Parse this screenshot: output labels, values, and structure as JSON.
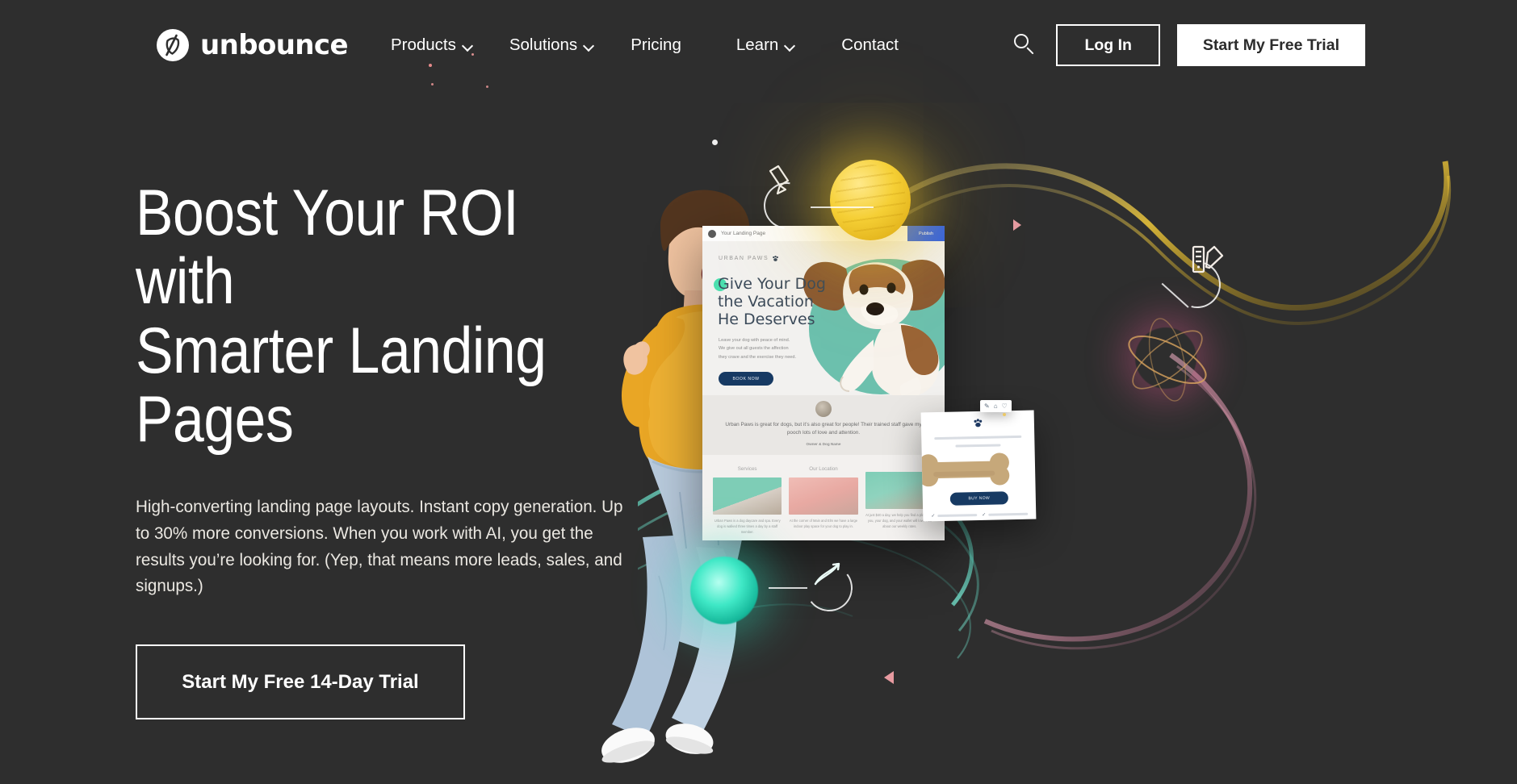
{
  "brand": {
    "name": "unbounce",
    "logo_icon": "unbounce-circle-logo"
  },
  "nav": {
    "items": [
      {
        "label": "Products",
        "has_dropdown": true
      },
      {
        "label": "Solutions",
        "has_dropdown": true
      },
      {
        "label": "Pricing",
        "has_dropdown": false
      },
      {
        "label": "Learn",
        "has_dropdown": true
      },
      {
        "label": "Contact",
        "has_dropdown": false
      }
    ],
    "search_icon": "search-icon",
    "login_label": "Log In",
    "trial_label": "Start My Free Trial"
  },
  "hero": {
    "headline": "Boost Your ROI with\nSmarter Landing\nPages",
    "subcopy": "High-converting landing page layouts. Instant copy generation. Up to 30% more conversions. When you work with AI, you get the results you’re looking for. (Yep, that means more leads, sales, and signups.)",
    "cta_label": "Start My Free 14-Day Trial"
  },
  "mockup": {
    "browser_label": "Your Landing Page",
    "publish_label": "Publish",
    "brand_label": "URBAN PAWS",
    "headline": "Give Your Dog\nthe Vacation\nHe Deserves",
    "paragraph": "Leave your dog with peace of mind.\nWe give out all guests the affection\nthey crave and the exercise they need.",
    "cta_label": "BOOK NOW",
    "testimonial_quote": "Urban Paws is great for dogs, but it’s also great for people! Their trained staff gave my pooch lots of love and attention.",
    "testimonial_attrib": "Owner & Dog Name",
    "columns": [
      {
        "title": "Services",
        "text": "Urban Paws is a dog daycare and spa.\nEvery dog is walked three times a day by\na staff member."
      },
      {
        "title": "Our Location",
        "text": "At the corner of Main and Elm we\nhave a large indoor play space\nfor your dog to play in."
      },
      {
        "title": "",
        "text": "At just $40 a day, we help you find a\nplace that you, your dog, and your wallet\nwill love. Ask about our weekly rates."
      }
    ]
  },
  "product_card": {
    "paw_icon": "paw-print-icon",
    "cta_label": "BUY NOW",
    "toolbar_icons": [
      "pen-icon",
      "home-icon",
      "heart-icon"
    ]
  },
  "decor": {
    "yellow_orb_icon": "pen-edit-icon",
    "pink_orb_icon": "color-palette-icon",
    "teal_orb_icon": "ab-split-test-icon"
  },
  "colors": {
    "background": "#2e2e2e",
    "text_light": "#ffffff",
    "body_text": "#ebe8e2",
    "accent_yellow": "#f5cf35",
    "accent_pink": "#f472a6",
    "accent_teal": "#3fe8c6",
    "mockup_blue": "#173a63",
    "mockup_teal": "#6cc0ad",
    "publish_blue": "#2d5fe8"
  }
}
